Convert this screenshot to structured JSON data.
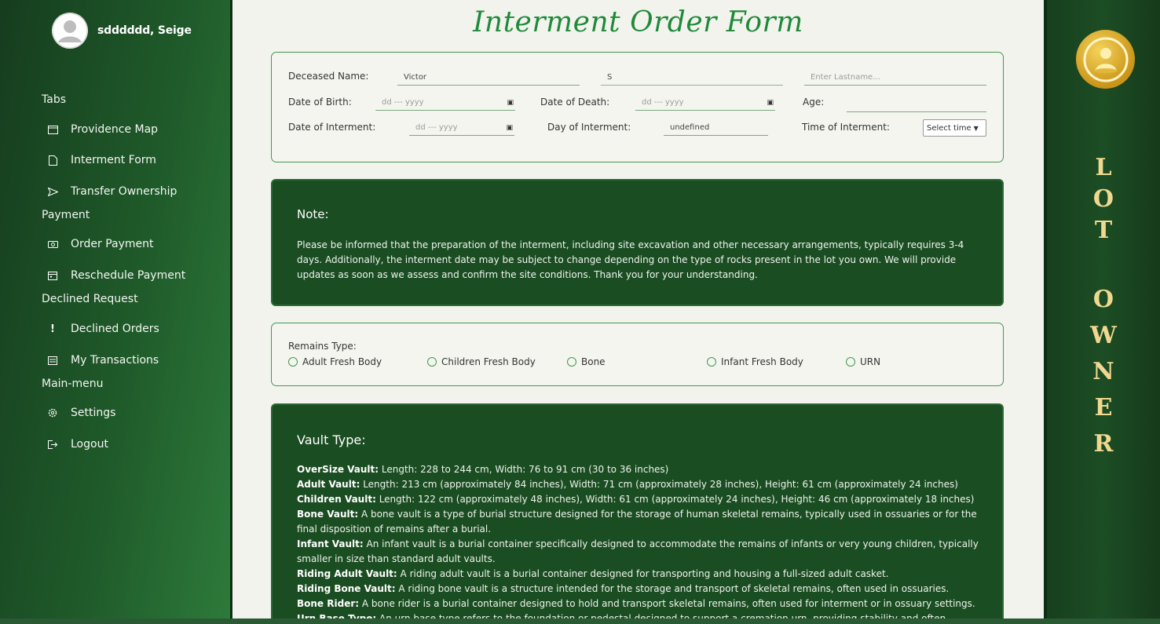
{
  "sidebar": {
    "username": "sdddddd, Seige",
    "sections": [
      {
        "title": "Tabs",
        "items": [
          {
            "label": "Providence Map",
            "icon": "map-icon"
          },
          {
            "label": "Interment Form",
            "icon": "document-icon"
          },
          {
            "label": "Transfer Ownership",
            "icon": "send-icon"
          }
        ]
      },
      {
        "title": "Payment",
        "items": [
          {
            "label": "Order Payment",
            "icon": "money-icon"
          },
          {
            "label": "Reschedule Payment",
            "icon": "calendar-icon"
          }
        ]
      },
      {
        "title": "Declined Request",
        "items": [
          {
            "label": "Declined Orders",
            "icon": "exclamation-icon"
          },
          {
            "label": "My Transactions",
            "icon": "receipt-icon"
          }
        ]
      },
      {
        "title": "Main-menu",
        "items": [
          {
            "label": "Settings",
            "icon": "gear-icon"
          },
          {
            "label": "Logout",
            "icon": "logout-icon"
          }
        ]
      }
    ]
  },
  "form": {
    "title": "Interment Order Form",
    "deceased_label": "Deceased Name:",
    "first_name_value": "Victor",
    "middle_name_value": "S",
    "last_name_placeholder": "Enter Lastname...",
    "dob_label": "Date of Birth:",
    "dod_label": "Date of Death:",
    "age_label": "Age:",
    "doi_label": "Date of Interment:",
    "day_label": "Day of Interment:",
    "day_value": "undefined",
    "time_label": "Time of Interment:",
    "time_select": "Select time",
    "date_placeholder": "dd --- yyyy"
  },
  "note": {
    "title": "Note:",
    "text": "Please be informed that the preparation of the interment, including site excavation and other necessary arrangements, typically requires 3-4 days. Additionally, the interment date may be subject to change depending on the type of rocks present in the lot you own. We will provide updates as soon as we assess and confirm the site conditions. Thank you for your understanding."
  },
  "remains": {
    "label": "Remains Type:",
    "options": [
      "Adult Fresh Body",
      "Children Fresh Body",
      "Bone",
      "Infant Fresh Body",
      "URN"
    ]
  },
  "vault": {
    "title": "Vault Type:",
    "items": [
      {
        "name": "OverSize Vault:",
        "desc": " Length: 228 to 244 cm, Width: 76 to 91 cm (30 to 36 inches)"
      },
      {
        "name": "Adult Vault:",
        "desc": " Length: 213 cm (approximately 84 inches), Width: 71 cm (approximately 28 inches), Height: 61 cm (approximately 24 inches)"
      },
      {
        "name": "Children Vault:",
        "desc": " Length: 122 cm (approximately 48 inches), Width: 61 cm (approximately 24 inches), Height: 46 cm (approximately 18 inches)"
      },
      {
        "name": "Bone Vault:",
        "desc": " A bone vault is a type of burial structure designed for the storage of human skeletal remains, typically used in ossuaries or for the final disposition of remains after a burial."
      },
      {
        "name": "Infant Vault:",
        "desc": " An infant vault is a burial container specifically designed to accommodate the remains of infants or very young children, typically smaller in size than standard adult vaults."
      },
      {
        "name": "Riding Adult Vault:",
        "desc": " A riding adult vault is a burial container designed for transporting and housing a full-sized adult casket."
      },
      {
        "name": "Riding Bone Vault:",
        "desc": " A riding bone vault is a structure intended for the storage and transport of skeletal remains, often used in ossuaries."
      },
      {
        "name": "Bone Rider:",
        "desc": " A bone rider is a burial container designed to hold and transport skeletal remains, often used for interment or in ossuary settings."
      },
      {
        "name": "Urn Base Type:",
        "desc": " An urn base type refers to the foundation or pedestal designed to support a cremation urn, providing stability and often"
      }
    ]
  },
  "right_panel": {
    "letters": [
      "L",
      "O",
      "T",
      "O",
      "W",
      "N",
      "E",
      "R"
    ]
  }
}
